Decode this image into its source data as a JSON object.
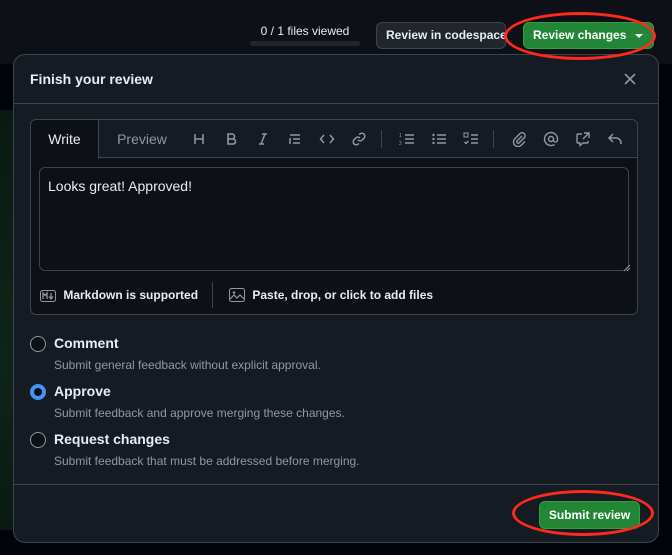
{
  "topbar": {
    "files_viewed": "0 / 1 files viewed",
    "codespace_label": "Review in codespace",
    "review_changes_label": "Review changes"
  },
  "dialog": {
    "title": "Finish your review",
    "close_icon": "close-icon",
    "editor": {
      "tabs": [
        {
          "label": "Write",
          "active": true
        },
        {
          "label": "Preview",
          "active": false
        }
      ],
      "toolbar_icons": [
        "heading-icon",
        "bold-icon",
        "italic-icon",
        "quote-icon",
        "code-icon",
        "link-icon",
        "numbered-list-icon",
        "bulleted-list-icon",
        "task-list-icon",
        "attach-icon",
        "mention-icon",
        "cross-reference-icon",
        "reply-icon"
      ],
      "text": "Looks great! Approved!",
      "markdown_note": "Markdown is supported",
      "attach_note": "Paste, drop, or click to add files"
    },
    "options": [
      {
        "label": "Comment",
        "description": "Submit general feedback without explicit approval.",
        "checked": false
      },
      {
        "label": "Approve",
        "description": "Submit feedback and approve merging these changes.",
        "checked": true
      },
      {
        "label": "Request changes",
        "description": "Submit feedback that must be addressed before merging.",
        "checked": false
      }
    ],
    "submit_label": "Submit review"
  },
  "colors": {
    "accent_green": "#238636",
    "radio_blue": "#4493f8",
    "annotation_red": "#ff2a1a"
  }
}
